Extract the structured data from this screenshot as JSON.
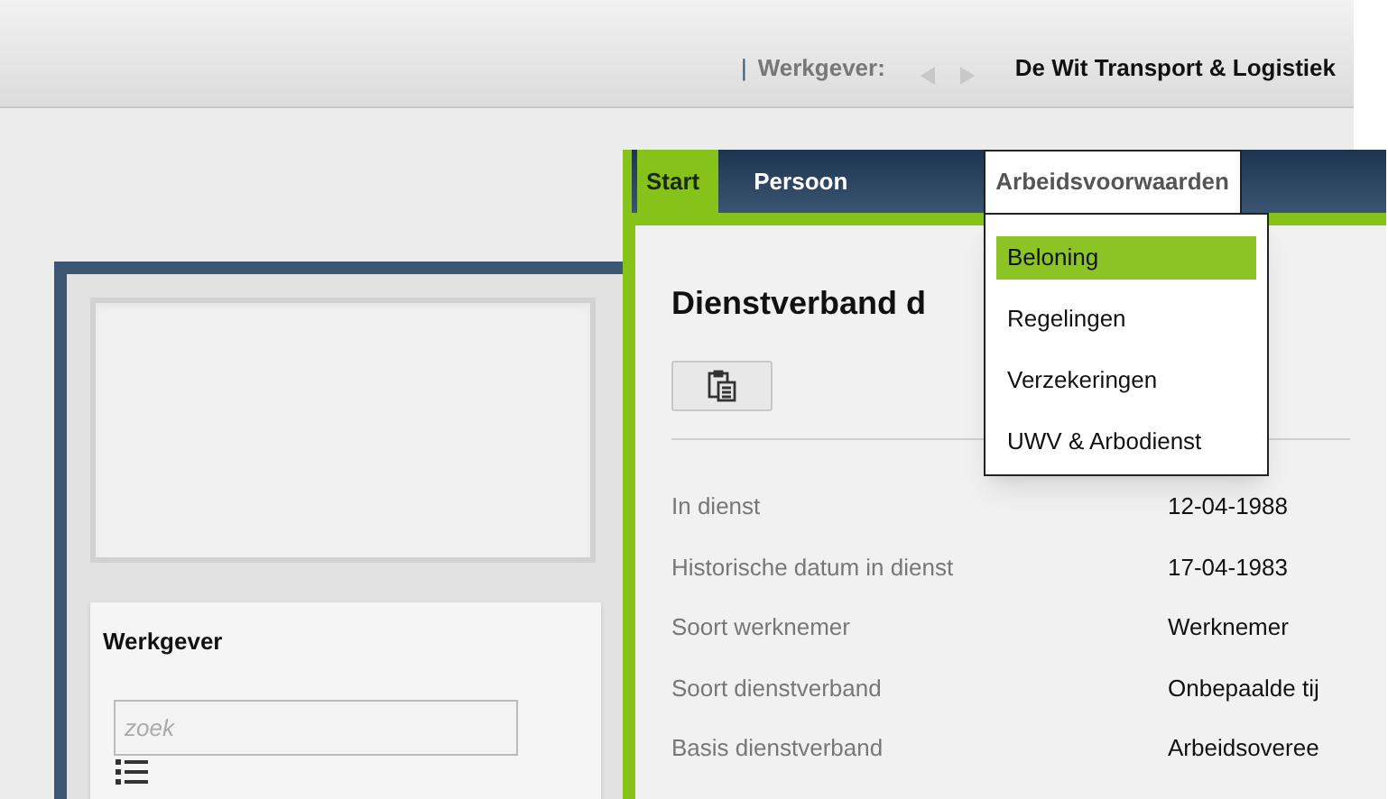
{
  "header": {
    "separator": "|",
    "label": "Werkgever:",
    "employer": "De Wit Transport & Logistiek"
  },
  "tabs": [
    {
      "label": "Start",
      "selected": true,
      "expanded": false
    },
    {
      "label": "Persoon",
      "selected": false,
      "expanded": false
    },
    {
      "label": "Arbeidsvoorwaarden",
      "selected": false,
      "expanded": true
    }
  ],
  "menu": [
    {
      "label": "Beloning",
      "selected": true
    },
    {
      "label": "Regelingen",
      "selected": false
    },
    {
      "label": "Verzekeringen",
      "selected": false
    },
    {
      "label": "UWV & Arbodienst",
      "selected": false
    }
  ],
  "section": {
    "title": "Dienstverband d"
  },
  "details": [
    {
      "label": "In dienst",
      "value": "12-04-1988"
    },
    {
      "label": "Historische datum in dienst",
      "value": "17-04-1983"
    },
    {
      "label": "Soort werknemer",
      "value": "Werknemer"
    },
    {
      "label": "Soort dienstverband",
      "value": "Onbepaalde tij"
    },
    {
      "label": "Basis dienstverband",
      "value": "Arbeidsoveree"
    }
  ],
  "sidebar": {
    "title": "Werkgever",
    "search": {
      "placeholder": "zoek"
    }
  }
}
